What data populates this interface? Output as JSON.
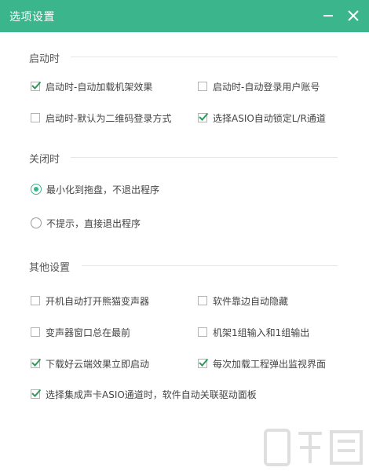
{
  "window": {
    "title": "选项设置"
  },
  "sections": {
    "startup": {
      "title": "启动时",
      "options": [
        {
          "label": "启动时-自动加载机架效果",
          "checked": true
        },
        {
          "label": "启动时-自动登录用户账号",
          "checked": false
        },
        {
          "label": "启动时-默认为二维码登录方式",
          "checked": false
        },
        {
          "label": "选择ASIO自动锁定L/R通道",
          "checked": true
        }
      ]
    },
    "close": {
      "title": "关闭时",
      "options": [
        {
          "label": "最小化到拖盘，不退出程序",
          "selected": true
        },
        {
          "label": "不提示，直接退出程序",
          "selected": false
        }
      ]
    },
    "other": {
      "title": "其他设置",
      "options": [
        {
          "label": "开机自动打开熊猫变声器",
          "checked": false
        },
        {
          "label": "软件靠边自动隐藏",
          "checked": false
        },
        {
          "label": "变声器窗口总在最前",
          "checked": false
        },
        {
          "label": "机架1组输入和1组输出",
          "checked": false
        },
        {
          "label": "下载好云端效果立即启动",
          "checked": true
        },
        {
          "label": "每次加载工程弹出监视界面",
          "checked": true
        },
        {
          "label": "选择集成声卡ASIO通道时，软件自动关联驱动面板",
          "checked": true
        }
      ]
    }
  },
  "colors": {
    "accent": "#3bb58c",
    "title_text": "#ffffff",
    "text": "#444444",
    "checkmark": "#2e9a5a"
  }
}
